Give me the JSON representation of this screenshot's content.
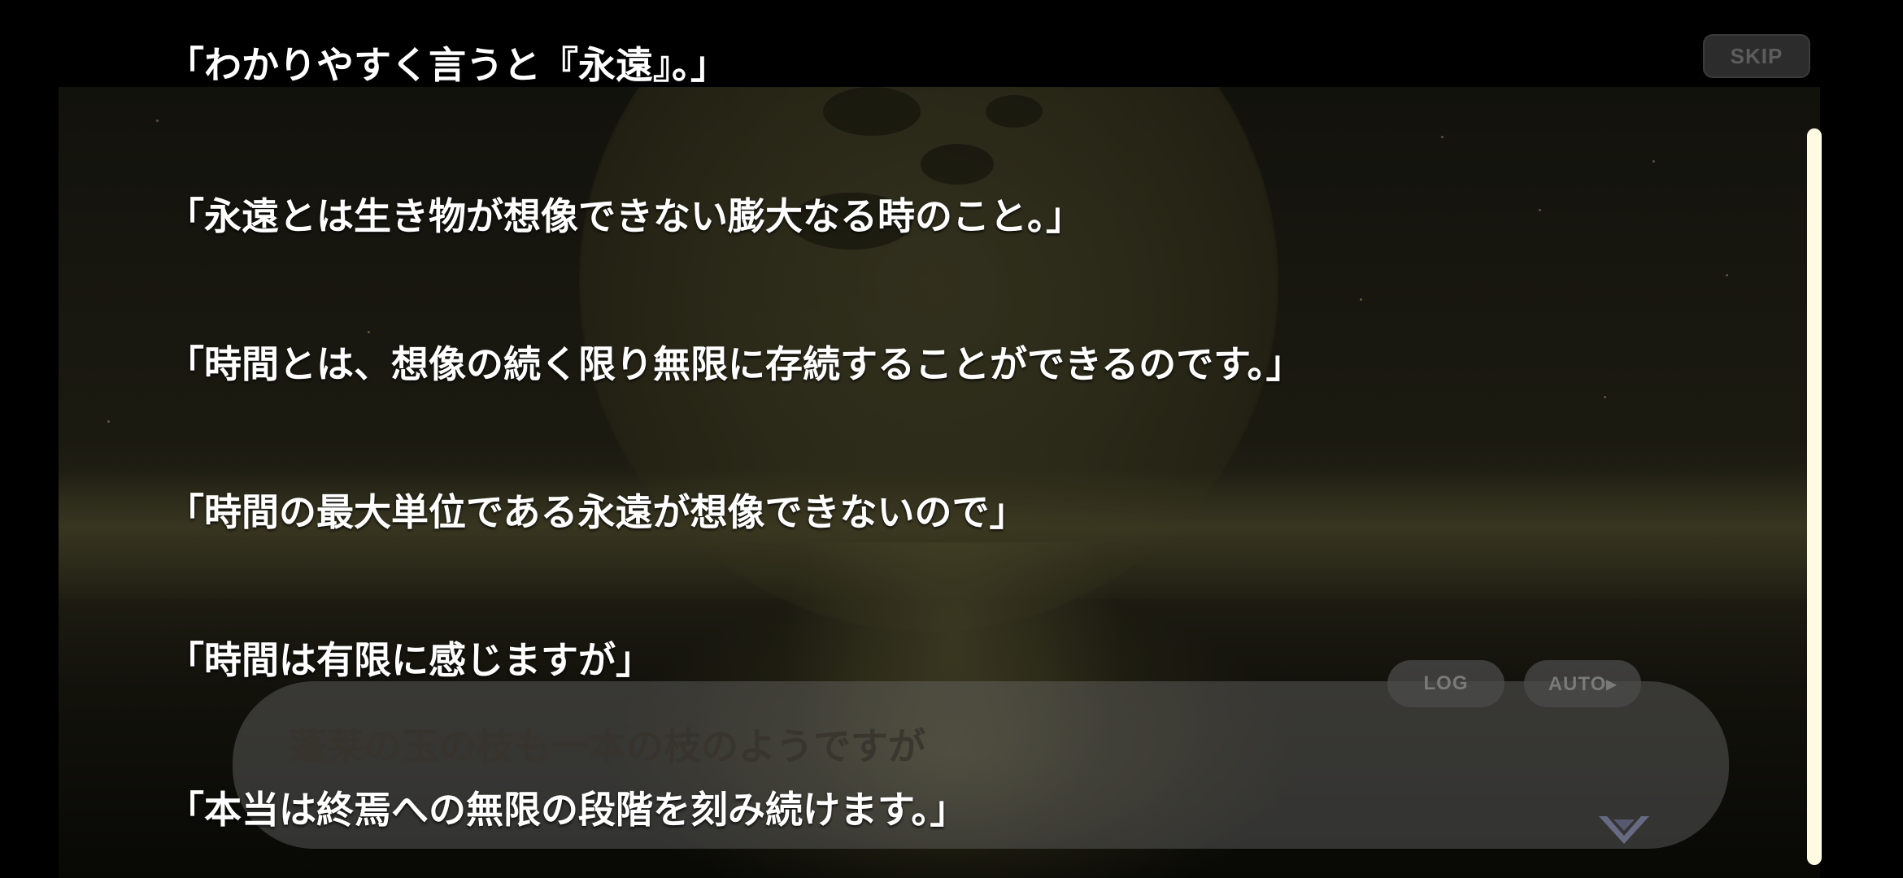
{
  "header": {
    "skip_label": "SKIP"
  },
  "backlog": {
    "lines": [
      "「わかりやすく言うと『永遠』。」",
      "「永遠とは生き物が想像できない膨大なる時のこと。」",
      "「時間とは、想像の続く限り無限に存続することができるのです。」",
      "「時間の最大単位である永遠が想像できないので」",
      "「時間は有限に感じますが」",
      "「本当は終焉への無限の段階を刻み続けます。」"
    ]
  },
  "message_window": {
    "text": "蓬莱の玉の枝も一本の枝のようですが",
    "log_label": "LOG",
    "auto_label": "AUTO▸"
  },
  "icons": {
    "next": "chevron-down-icon"
  },
  "colors": {
    "text": "#ffffff",
    "scrollbar": "#fffbe2"
  }
}
